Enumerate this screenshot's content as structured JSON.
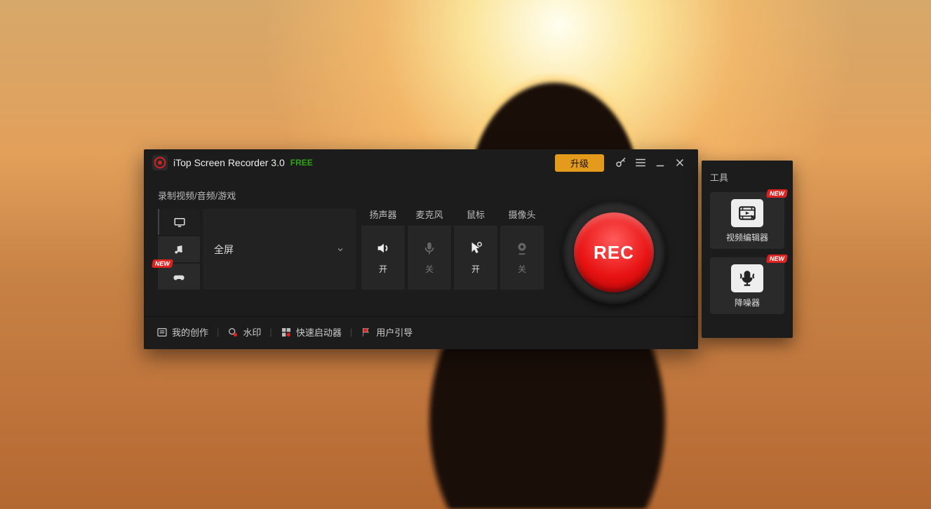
{
  "titlebar": {
    "app_name": "iTop Screen Recorder 3.0",
    "free_label": "FREE",
    "upgrade_label": "升级"
  },
  "main": {
    "source_label": "录制视频/音频/游戏",
    "source_select": "全屏",
    "new_badge": "NEW",
    "toggles": {
      "speaker": {
        "label": "扬声器",
        "state": "开"
      },
      "mic": {
        "label": "麦克风",
        "state": "关"
      },
      "mouse": {
        "label": "鼠标",
        "state": "开"
      },
      "camera": {
        "label": "摄像头",
        "state": "关"
      }
    },
    "rec_label": "REC"
  },
  "footer": {
    "my_creations": "我的创作",
    "watermark": "水印",
    "launcher": "快速启动器",
    "guide": "用户引导"
  },
  "tools": {
    "title": "工具",
    "video_editor": "视频编辑器",
    "denoiser": "降噪器",
    "new_badge": "NEW"
  }
}
